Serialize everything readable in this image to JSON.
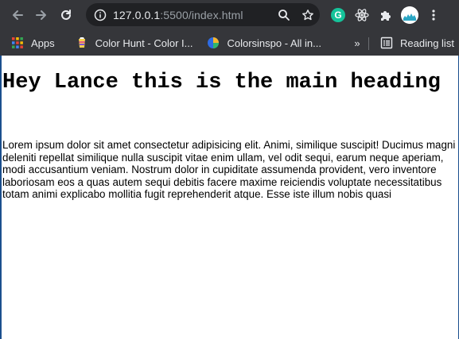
{
  "browser": {
    "url_host": "127.0.0.1",
    "url_rest": ":5500/index.html",
    "reading_list_label": "Reading list",
    "bookmarks": [
      {
        "label": "Apps",
        "icon": "apps-grid-icon"
      },
      {
        "label": "Color Hunt - Color I...",
        "icon": "color-hunt-icon"
      },
      {
        "label": "Colorsinspo - All in...",
        "icon": "colorsinspo-icon"
      }
    ],
    "more_bookmarks": "»",
    "extensions": {
      "grammarly_letter": "G"
    },
    "colors": {
      "toolbar_bg": "#35363a",
      "omnibox_bg": "#202124",
      "grammarly": "#15c39a",
      "viewport_border": "#1b4f8e"
    }
  },
  "page": {
    "heading": "Hey Lance this is the main heading",
    "paragraph": "Lorem ipsum dolor sit amet consectetur adipisicing elit. Animi, similique suscipit! Ducimus magni deleniti repellat similique nulla suscipit vitae enim ullam, vel odit sequi, earum neque aperiam, modi accusantium veniam. Nostrum dolor in cupiditate assumenda provident, vero inventore laboriosam eos a quas autem sequi debitis facere maxime reiciendis voluptate necessitatibus totam animi explicabo mollitia fugit reprehenderit atque. Esse iste illum nobis quasi"
  }
}
